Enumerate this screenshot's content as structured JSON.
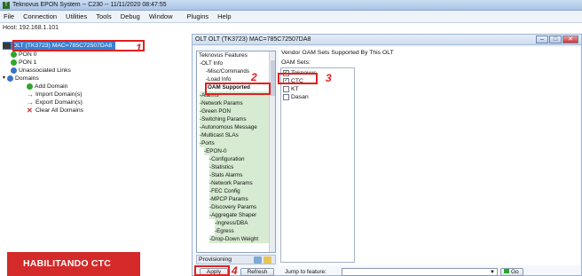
{
  "window": {
    "title": "Teknovus EPON System -- C230 -- 11/11/2020 08:47:55",
    "app_icon": "T"
  },
  "menu": [
    "File",
    "Connection",
    "Utilities",
    "Tools",
    "Debug",
    "Window",
    "Plugins",
    "Help"
  ],
  "host": "Host: 192.168.1.101",
  "tree": {
    "olt_label": "OLT (TK3723) MAC=785C72507DA8",
    "pon0": "PON 0",
    "pon1": "PON 1",
    "unassociated": "Unassociated Links",
    "domains": "Domains",
    "add_domain": "Add Domain",
    "import_domain": "Import Domain(s)",
    "export_domain": "Export Domain(s)",
    "clear_domains": "Clear All Domains"
  },
  "banner": "HABILITANDO CTC",
  "olt_window": {
    "title": "OLT OLT (TK3723) MAC=785C72507DA8",
    "buttons": [
      "–",
      "□",
      "✕"
    ]
  },
  "features": {
    "header": "Teknovus Features",
    "items": [
      "-OLT Info",
      "-Misc/Commands",
      "-Load Info",
      "OAM Supported",
      "-Alarms",
      "-Network Params",
      "-Green PON",
      "-Switching Params",
      "-Autonomous Message",
      "-Multicast SLAs",
      "-Ports",
      "-EPON-0",
      "-Configuration",
      "-Statistics",
      "-Stats Alarms",
      "-Network Params",
      "-FEC Config",
      "-MPCP Params",
      "-Discovery Params",
      "-Aggregate Shaper",
      "-Ingress/DBA",
      "-Egress",
      "-Drop-Down Weight"
    ]
  },
  "provisioning_label": "Provisioning",
  "oam": {
    "title": "Vendor OAM Sets Supported By This OLT",
    "sets_label": "OAM Sets:",
    "items": [
      {
        "label": "Teknovus",
        "checked": true
      },
      {
        "label": "CTC",
        "checked": true
      },
      {
        "label": "KT",
        "checked": false
      },
      {
        "label": "Dasan",
        "checked": false
      }
    ]
  },
  "bottom": {
    "apply": "Apply",
    "refresh": "Refresh",
    "jump_label": "Jump to feature:",
    "go": "Go"
  },
  "annotations": {
    "n1": "1",
    "n2": "2",
    "n3": "3",
    "n4": "4"
  },
  "colors": {
    "annotation_red": "#e02020",
    "banner_red": "#d42a2a",
    "selection_blue": "#3c7fd1"
  }
}
